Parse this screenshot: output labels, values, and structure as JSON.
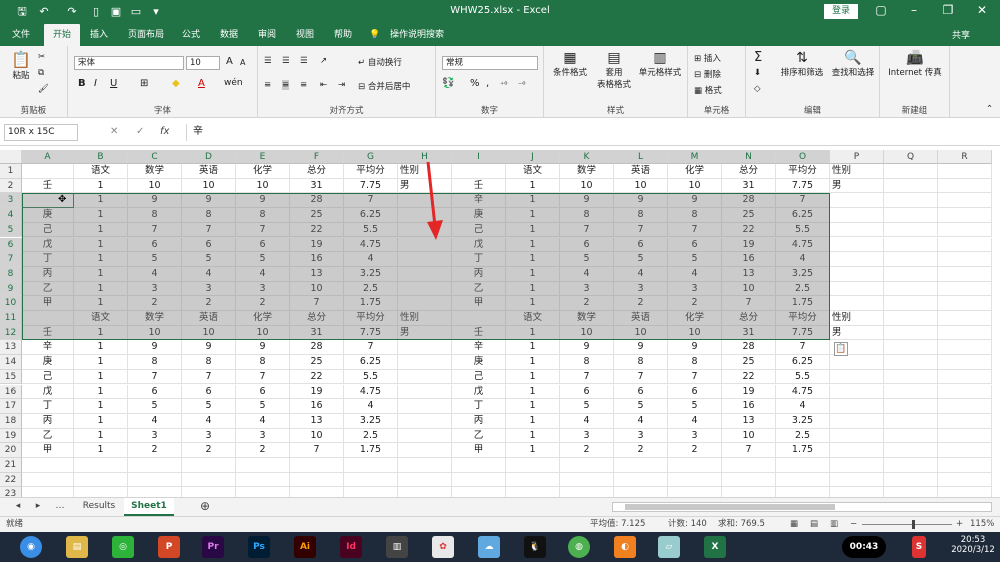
{
  "titlebar": {
    "title": "WHW25.xlsx  -  Excel",
    "login": "登录"
  },
  "tabs": [
    "文件",
    "开始",
    "插入",
    "页面布局",
    "公式",
    "数据",
    "审阅",
    "视图",
    "帮助",
    "操作说明搜索"
  ],
  "share": "共享",
  "ribbon": {
    "clipboard": {
      "label": "剪贴板",
      "paste": "粘贴"
    },
    "font": {
      "label": "字体",
      "name": "宋体",
      "size": "10",
      "bold": "B",
      "italic": "I",
      "underline": "U",
      "grow": "A",
      "shrink": "A"
    },
    "align": {
      "label": "对齐方式",
      "wrap": "自动换行",
      "merge": "合并后居中"
    },
    "number": {
      "label": "数字",
      "format": "常规",
      "percent": "%",
      "comma": ","
    },
    "styles": {
      "label": "样式",
      "cond": "条件格式",
      "table": "套用\n表格格式",
      "cell": "单元格样式"
    },
    "cells": {
      "label": "单元格",
      "insert": "插入",
      "delete": "删除",
      "format": "格式"
    },
    "edit": {
      "label": "编辑",
      "sum": "Σ",
      "sort": "排序和筛选",
      "find": "查找和选择"
    },
    "newgroup": {
      "label": "新建组",
      "ie": "Internet 传真"
    }
  },
  "formula_bar": {
    "namebox": "10R x 15C",
    "cancel": "✕",
    "enter": "✓",
    "fx": "fx",
    "content": "辛"
  },
  "columns": [
    "A",
    "B",
    "C",
    "D",
    "E",
    "F",
    "G",
    "H",
    "I",
    "J",
    "K",
    "L",
    "M",
    "N",
    "O",
    "P",
    "Q",
    "R"
  ],
  "rows": [
    [
      "",
      "语文",
      "数学",
      "英语",
      "化学",
      "总分",
      "平均分",
      "性别",
      "",
      "语文",
      "数学",
      "英语",
      "化学",
      "总分",
      "平均分",
      "性别",
      "",
      ""
    ],
    [
      "壬",
      "1",
      "10",
      "10",
      "10",
      "31",
      "7.75",
      "男",
      "壬",
      "1",
      "10",
      "10",
      "10",
      "31",
      "7.75",
      "男",
      "",
      ""
    ],
    [
      "辛",
      "1",
      "9",
      "9",
      "9",
      "28",
      "7",
      "",
      "辛",
      "1",
      "9",
      "9",
      "9",
      "28",
      "7",
      "",
      "",
      ""
    ],
    [
      "庚",
      "1",
      "8",
      "8",
      "8",
      "25",
      "6.25",
      "",
      "庚",
      "1",
      "8",
      "8",
      "8",
      "25",
      "6.25",
      "",
      "",
      ""
    ],
    [
      "己",
      "1",
      "7",
      "7",
      "7",
      "22",
      "5.5",
      "",
      "己",
      "1",
      "7",
      "7",
      "7",
      "22",
      "5.5",
      "",
      "",
      ""
    ],
    [
      "戊",
      "1",
      "6",
      "6",
      "6",
      "19",
      "4.75",
      "",
      "戊",
      "1",
      "6",
      "6",
      "6",
      "19",
      "4.75",
      "",
      "",
      ""
    ],
    [
      "丁",
      "1",
      "5",
      "5",
      "5",
      "16",
      "4",
      "",
      "丁",
      "1",
      "5",
      "5",
      "5",
      "16",
      "4",
      "",
      "",
      ""
    ],
    [
      "丙",
      "1",
      "4",
      "4",
      "4",
      "13",
      "3.25",
      "",
      "丙",
      "1",
      "4",
      "4",
      "4",
      "13",
      "3.25",
      "",
      "",
      ""
    ],
    [
      "乙",
      "1",
      "3",
      "3",
      "3",
      "10",
      "2.5",
      "",
      "乙",
      "1",
      "3",
      "3",
      "3",
      "10",
      "2.5",
      "",
      "",
      ""
    ],
    [
      "甲",
      "1",
      "2",
      "2",
      "2",
      "7",
      "1.75",
      "",
      "甲",
      "1",
      "2",
      "2",
      "2",
      "7",
      "1.75",
      "",
      "",
      ""
    ],
    [
      "",
      "语文",
      "数学",
      "英语",
      "化学",
      "总分",
      "平均分",
      "性别",
      "",
      "语文",
      "数学",
      "英语",
      "化学",
      "总分",
      "平均分",
      "性别",
      "",
      ""
    ],
    [
      "壬",
      "1",
      "10",
      "10",
      "10",
      "31",
      "7.75",
      "男",
      "壬",
      "1",
      "10",
      "10",
      "10",
      "31",
      "7.75",
      "男",
      "",
      ""
    ],
    [
      "辛",
      "1",
      "9",
      "9",
      "9",
      "28",
      "7",
      "",
      "辛",
      "1",
      "9",
      "9",
      "9",
      "28",
      "7",
      "",
      "",
      ""
    ],
    [
      "庚",
      "1",
      "8",
      "8",
      "8",
      "25",
      "6.25",
      "",
      "庚",
      "1",
      "8",
      "8",
      "8",
      "25",
      "6.25",
      "",
      "",
      ""
    ],
    [
      "己",
      "1",
      "7",
      "7",
      "7",
      "22",
      "5.5",
      "",
      "己",
      "1",
      "7",
      "7",
      "7",
      "22",
      "5.5",
      "",
      "",
      ""
    ],
    [
      "戊",
      "1",
      "6",
      "6",
      "6",
      "19",
      "4.75",
      "",
      "戊",
      "1",
      "6",
      "6",
      "6",
      "19",
      "4.75",
      "",
      "",
      ""
    ],
    [
      "丁",
      "1",
      "5",
      "5",
      "5",
      "16",
      "4",
      "",
      "丁",
      "1",
      "5",
      "5",
      "5",
      "16",
      "4",
      "",
      "",
      ""
    ],
    [
      "丙",
      "1",
      "4",
      "4",
      "4",
      "13",
      "3.25",
      "",
      "丙",
      "1",
      "4",
      "4",
      "4",
      "13",
      "3.25",
      "",
      "",
      ""
    ],
    [
      "乙",
      "1",
      "3",
      "3",
      "3",
      "10",
      "2.5",
      "",
      "乙",
      "1",
      "3",
      "3",
      "3",
      "10",
      "2.5",
      "",
      "",
      ""
    ],
    [
      "甲",
      "1",
      "2",
      "2",
      "2",
      "7",
      "1.75",
      "",
      "甲",
      "1",
      "2",
      "2",
      "2",
      "7",
      "1.75",
      "",
      "",
      ""
    ],
    [
      "",
      "",
      "",
      "",
      "",
      "",
      "",
      "",
      "",
      "",
      "",
      "",
      "",
      "",
      "",
      "",
      "",
      ""
    ],
    [
      "",
      "",
      "",
      "",
      "",
      "",
      "",
      "",
      "",
      "",
      "",
      "",
      "",
      "",
      "",
      "",
      "",
      ""
    ],
    [
      "",
      "",
      "",
      "",
      "",
      "",
      "",
      "",
      "",
      "",
      "",
      "",
      "",
      "",
      "",
      "",
      "",
      ""
    ]
  ],
  "sheets": [
    "Results",
    "Sheet1"
  ],
  "active_sheet": "Sheet1",
  "status": {
    "ready": "就绪",
    "average": "平均值: 7.125",
    "count": "计数: 140",
    "sum": "求和: 769.5",
    "zoom": "115%"
  },
  "taskbar": {
    "time": "20:53",
    "date": "2020/3/12",
    "timer": "00:43"
  }
}
